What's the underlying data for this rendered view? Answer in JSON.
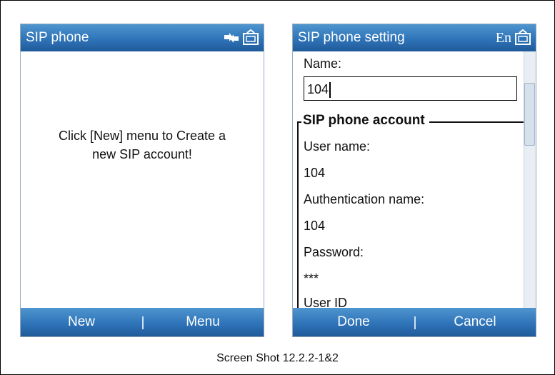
{
  "caption": "Screen Shot 12.2.2-1&2",
  "screen1": {
    "title": "SIP phone",
    "message_line1": "Click [New] menu to Create a",
    "message_line2": "new SIP account!",
    "softkeys": {
      "left": "New",
      "right": "Menu"
    },
    "icons": [
      "sync-icon",
      "keyboard-input-icon"
    ]
  },
  "screen2": {
    "title": "SIP phone setting",
    "input_mode": "En",
    "name_label": "Name:",
    "name_value": "104",
    "group_title": "SIP phone account",
    "fields": [
      {
        "label": "User name:",
        "value": "104"
      },
      {
        "label": "Authentication name:",
        "value": "104"
      },
      {
        "label": "Password:",
        "value": "***"
      }
    ],
    "partial_label": "User ID",
    "softkeys": {
      "left": "Done",
      "right": "Cancel"
    },
    "icons": [
      "keyboard-input-icon"
    ]
  }
}
